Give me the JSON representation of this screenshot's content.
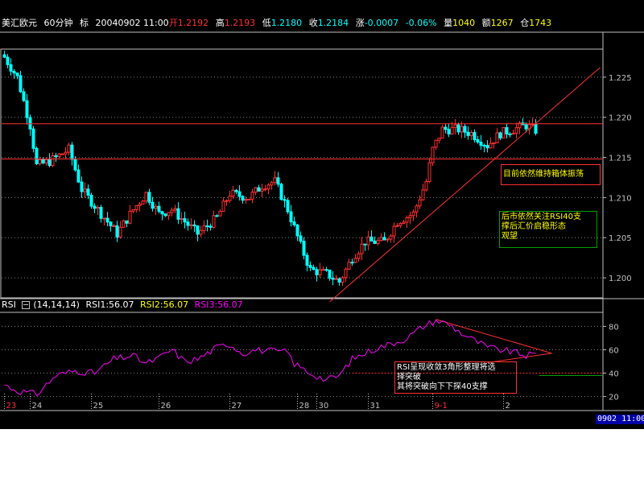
{
  "header": {
    "symbol": "美汇欧元",
    "period": "60分钟",
    "mode": "标",
    "datetime": "20040902 11:00",
    "open_label": "开",
    "open": "1.2192",
    "high_label": "高",
    "high": "1.2193",
    "low_label": "低",
    "low": "1.2180",
    "close_label": "收",
    "close": "1.2184",
    "change_label": "涨",
    "change": "-0.0007",
    "change_pct": "-0.06%",
    "volume_label": "量",
    "volume": "1040",
    "amount_label": "额",
    "amount": "1267",
    "position_label": "仓",
    "position": "1743"
  },
  "rsi_header": {
    "name": "RSI",
    "params": "(14,14,14)",
    "rsi1": "RSI1:56.07",
    "rsi2": "RSI2:56.07",
    "rsi3": "RSI3:56.07"
  },
  "notes": {
    "note1": "目前依然维持箱体振荡",
    "note2_line1": "后市依然关注RSI40支",
    "note2_line2": "撑后汇价启稳形态",
    "note2_line3": "观望",
    "note3_line1": "RSI呈现收敛3角形整理将选",
    "note3_line2": "择突破",
    "note3_line3": "其将突破向下下探40支撑"
  },
  "timestamp": "0902 11:00",
  "colors": {
    "background": "#000000",
    "up": "#ff3030",
    "down": "#00ffff",
    "rsi_line": "#ff00ff",
    "grid": "#808080",
    "header_white": "#ffffff",
    "header_yellow": "#ffff00",
    "header_red": "#ff3030",
    "header_cyan": "#00ffff"
  },
  "chart_data": [
    {
      "type": "candlestick",
      "yaxis_ticks": [
        1.2,
        1.205,
        1.21,
        1.215,
        1.22,
        1.225
      ],
      "ylim": [
        1.1975,
        1.2285
      ],
      "x_labels": [
        "23",
        "24",
        "25",
        "26",
        "27",
        "28",
        "30",
        "31",
        "9-1",
        "2"
      ],
      "x_label_positions": [
        0,
        8,
        27,
        48,
        70,
        91,
        97,
        113,
        133,
        155
      ],
      "n_bars": 166,
      "anchors": [
        [
          0,
          1.2275
        ],
        [
          4,
          1.225
        ],
        [
          8,
          1.219
        ],
        [
          10,
          1.214
        ],
        [
          14,
          1.2145
        ],
        [
          20,
          1.216
        ],
        [
          24,
          1.211
        ],
        [
          28,
          1.209
        ],
        [
          35,
          1.2055
        ],
        [
          40,
          1.2085
        ],
        [
          44,
          1.2105
        ],
        [
          48,
          1.208
        ],
        [
          52,
          1.2085
        ],
        [
          56,
          1.207
        ],
        [
          60,
          1.2055
        ],
        [
          66,
          1.2075
        ],
        [
          70,
          1.2105
        ],
        [
          76,
          1.21
        ],
        [
          80,
          1.2115
        ],
        [
          84,
          1.212
        ],
        [
          88,
          1.2085
        ],
        [
          92,
          1.204
        ],
        [
          95,
          1.201
        ],
        [
          100,
          1.2005
        ],
        [
          104,
          1.1995
        ],
        [
          108,
          1.2025
        ],
        [
          112,
          1.2045
        ],
        [
          118,
          1.2045
        ],
        [
          122,
          1.207
        ],
        [
          127,
          1.208
        ],
        [
          131,
          1.212
        ],
        [
          133,
          1.216
        ],
        [
          136,
          1.2185
        ],
        [
          141,
          1.2185
        ],
        [
          145,
          1.218
        ],
        [
          150,
          1.2165
        ],
        [
          154,
          1.218
        ],
        [
          158,
          1.2185
        ],
        [
          162,
          1.219
        ],
        [
          165,
          1.2184
        ]
      ],
      "resistance_level": 1.2192,
      "support_level": 1.2148,
      "trendline": {
        "from": [
          101,
          1.197
        ],
        "to": [
          185,
          1.2262
        ]
      }
    },
    {
      "type": "line",
      "name": "RSI",
      "yaxis_ticks": [
        20,
        40,
        60,
        80
      ],
      "ylim": [
        8,
        92
      ],
      "anchors": [
        [
          0,
          30
        ],
        [
          4,
          25
        ],
        [
          10,
          22
        ],
        [
          16,
          38
        ],
        [
          22,
          42
        ],
        [
          28,
          40
        ],
        [
          34,
          52
        ],
        [
          40,
          55
        ],
        [
          44,
          48
        ],
        [
          48,
          53
        ],
        [
          52,
          60
        ],
        [
          56,
          50
        ],
        [
          60,
          52
        ],
        [
          66,
          62
        ],
        [
          70,
          65
        ],
        [
          74,
          57
        ],
        [
          78,
          60
        ],
        [
          82,
          59
        ],
        [
          88,
          58
        ],
        [
          90,
          48
        ],
        [
          95,
          40
        ],
        [
          100,
          34
        ],
        [
          104,
          38
        ],
        [
          108,
          52
        ],
        [
          112,
          57
        ],
        [
          116,
          62
        ],
        [
          120,
          65
        ],
        [
          125,
          70
        ],
        [
          130,
          80
        ],
        [
          134,
          85
        ],
        [
          138,
          82
        ],
        [
          142,
          74
        ],
        [
          146,
          68
        ],
        [
          150,
          62
        ],
        [
          154,
          60
        ],
        [
          158,
          58
        ],
        [
          162,
          55
        ],
        [
          165,
          56
        ]
      ],
      "levels": [
        40
      ],
      "triangle_upper": {
        "from": [
          134,
          86
        ],
        "to": [
          170,
          57
        ]
      },
      "triangle_lower": {
        "from": [
          150,
          49
        ],
        "to": [
          170,
          57
        ]
      }
    }
  ]
}
